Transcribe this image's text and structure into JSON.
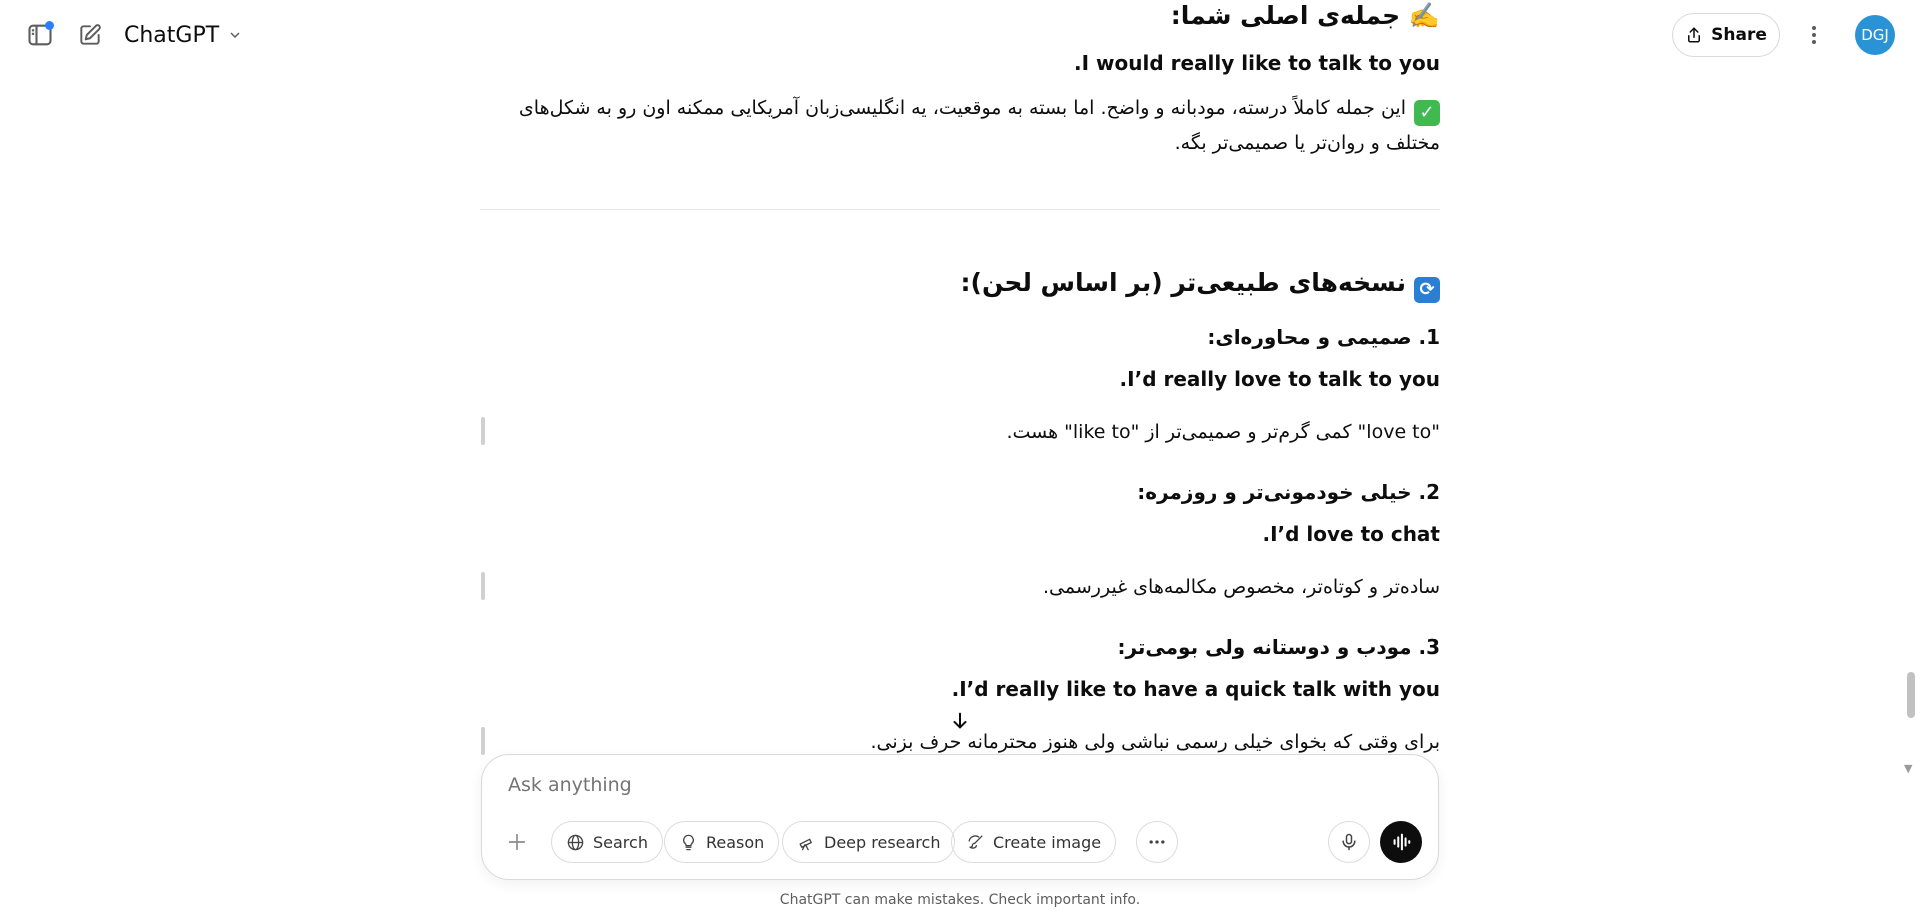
{
  "header": {
    "model_name": "ChatGPT",
    "share_label": "Share",
    "avatar_initials": "DGJ"
  },
  "message": {
    "section1_heading": "✍️ جمله‌ی اصلی شما:",
    "original_sentence": "I would really like to talk to you.",
    "assessment": "این جمله کاملاً درسته، مودبانه و واضح. اما بسته به موقعیت، یه انگلیسی‌زبان آمریکایی ممکنه اون رو به شکل‌های مختلف و روان‌تر یا صمیمی‌تر بگه.",
    "section2_heading": "نسخه‌های طبیعی‌تر (بر اساس لحن):",
    "items": [
      {
        "title": "1. صمیمی و محاوره‌ای:",
        "sentence": "I’d really love to talk to you.",
        "note": "\"love to\" کمی گرم‌تر و صمیمی‌تر از \"like to\" هست."
      },
      {
        "title": "2. خیلی خودمونی‌تر و روزمره:",
        "sentence": "I’d love to chat.",
        "note": "ساده‌تر و کوتاه‌تر، مخصوص مکالمه‌های غیررسمی."
      },
      {
        "title": "3. مودب و دوستانه ولی بومی‌تر:",
        "sentence": "I’d really like to have a quick talk with you.",
        "note": "برای وقتی که بخوای خیلی رسمی نباشی ولی هنوز محترمانه حرف بزنی."
      }
    ]
  },
  "composer": {
    "placeholder": "Ask anything",
    "tools": {
      "search": "Search",
      "reason": "Reason",
      "deep_research": "Deep research",
      "create_image": "Create image"
    }
  },
  "footer": {
    "disclaimer": "ChatGPT can make mistakes. Check important info."
  },
  "icons": {
    "sidebar_toggle": "sidebar-icon",
    "new_chat": "edit-icon",
    "more": "dots-vertical-icon",
    "scroll_down": "arrow-down-icon"
  },
  "colors": {
    "accent_blue": "#2b7fff",
    "avatar_bg": "#2a93d5",
    "check_green": "#3fb950"
  }
}
